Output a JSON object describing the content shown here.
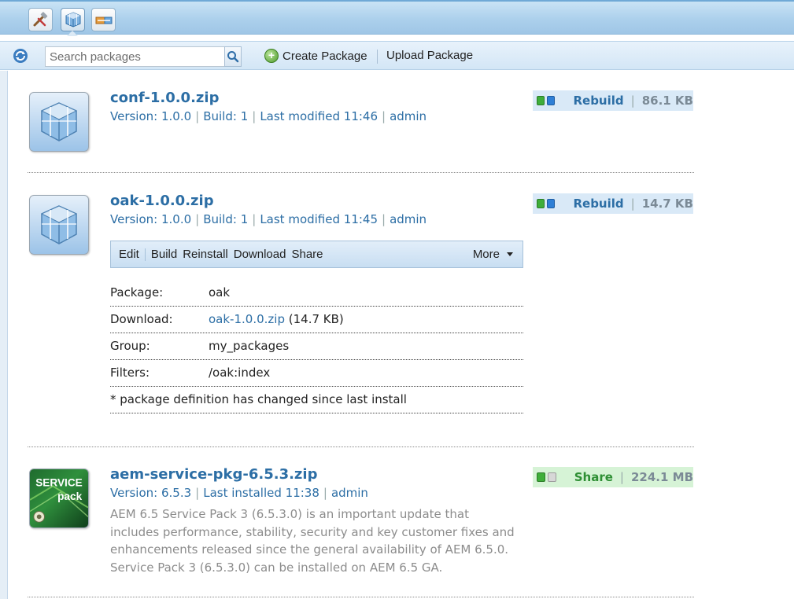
{
  "toolbar": {
    "search_placeholder": "Search packages",
    "create_label": "Create Package",
    "upload_label": "Upload Package"
  },
  "packages": [
    {
      "name": "conf-1.0.0.zip",
      "version": "Version: 1.0.0",
      "build": "Build: 1",
      "modified": "Last modified 11:46",
      "user": "admin",
      "status_action": "Rebuild",
      "size": "86.1 KB"
    },
    {
      "name": "oak-1.0.0.zip",
      "version": "Version: 1.0.0",
      "build": "Build: 1",
      "modified": "Last modified 11:45",
      "user": "admin",
      "status_action": "Rebuild",
      "size": "14.7 KB",
      "actions": [
        "Edit",
        "Build",
        "Reinstall",
        "Download",
        "Share"
      ],
      "more_label": "More",
      "details": {
        "package_label": "Package:",
        "package_value": "oak",
        "download_label": "Download:",
        "download_link": "oak-1.0.0.zip",
        "download_size": "(14.7 KB)",
        "group_label": "Group:",
        "group_value": "my_packages",
        "filters_label": "Filters:",
        "filters_value": "/oak:index",
        "note": "* package definition has changed since last install"
      }
    },
    {
      "name": "aem-service-pkg-6.5.3.zip",
      "version": "Version: 6.5.3",
      "installed": "Last installed 11:38",
      "user": "admin",
      "status_action": "Share",
      "size": "224.1 MB",
      "icon_text_top": "SERVICE",
      "icon_text_bottom": "pack",
      "description": "AEM 6.5 Service Pack 3 (6.5.3.0) is an important update that includes performance, stability, security and key customer fixes and enhancements released since the general availability of AEM 6.5.0. Service Pack 3 (6.5.3.0) can be installed on AEM 6.5 GA."
    }
  ]
}
